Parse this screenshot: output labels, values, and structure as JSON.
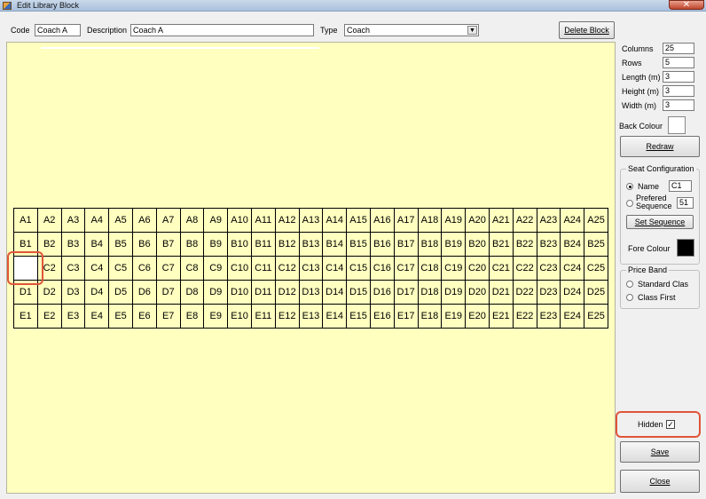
{
  "window": {
    "title": "Edit Library Block",
    "close_glyph": "✕"
  },
  "header": {
    "code_label": "Code",
    "code_value": "Coach A",
    "description_label": "Description",
    "description_value": "Coach A",
    "type_label": "Type",
    "type_value": "Coach",
    "delete_label": "Delete Block"
  },
  "seats": {
    "rows": [
      "A",
      "B",
      "C",
      "D",
      "E"
    ],
    "columns": 25,
    "hidden": [
      "C1"
    ]
  },
  "dims": {
    "columns_label": "Columns",
    "columns_value": "25",
    "rows_label": "Rows",
    "rows_value": "5",
    "length_label": "Length (m)",
    "length_value": "3",
    "height_label": "Height (m)",
    "height_value": "3",
    "width_label": "Width (m)",
    "width_value": "3",
    "back_colour_label": "Back Colour",
    "back_colour": "#ffffff",
    "redraw_label": "Redraw"
  },
  "seat_config": {
    "title": "Seat Configuration",
    "name_label": "Name",
    "name_value": "C1",
    "pref_label_1": "Prefered",
    "pref_label_2": "Sequence",
    "pref_value": "51",
    "set_sequence_label": "Set Sequence",
    "fore_colour_label": "Fore Colour",
    "fore_colour": "#000000"
  },
  "price_band": {
    "title": "Price Band",
    "option1": "Standard Clas",
    "option2": "Class First"
  },
  "hidden_label": "Hidden",
  "hidden_checked": "✓",
  "save_label": "Save",
  "close_label": "Close",
  "accent_color": "#e05538",
  "canvas_color": "#ffffc0"
}
